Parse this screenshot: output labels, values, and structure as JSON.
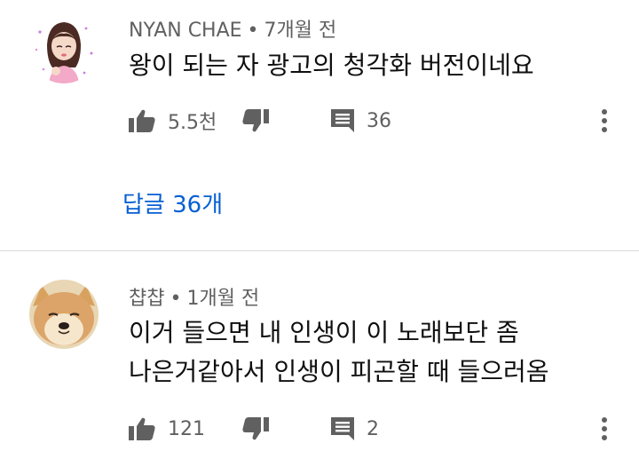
{
  "comments": [
    {
      "author": "NYAN CHAE",
      "separator": "•",
      "time": "7개월 전",
      "lines": [
        "왕이 되는 자 광고의 청각화 버전이네요"
      ],
      "likes": "5.5천",
      "replies_count": "36",
      "replies_link": "답글 36개",
      "avatar": "avatar-girl-cartoon"
    },
    {
      "author": "챱챱",
      "separator": "•",
      "time": "1개월 전",
      "lines": [
        "이거 들으면 내 인생이 이 노래보단 좀",
        "나은거같아서 인생이 피곤할 때 들으러옴"
      ],
      "likes": "121",
      "replies_count": "2",
      "avatar": "avatar-shiba-dog"
    }
  ],
  "icons": {
    "like": "thumbs-up-icon",
    "dislike": "thumbs-down-icon",
    "reply": "comment-icon",
    "more": "more-vertical-icon"
  },
  "colors": {
    "text": "#0f0f0f",
    "secondary": "#606060",
    "link": "#065fd4",
    "divider": "#d9d9d9"
  }
}
